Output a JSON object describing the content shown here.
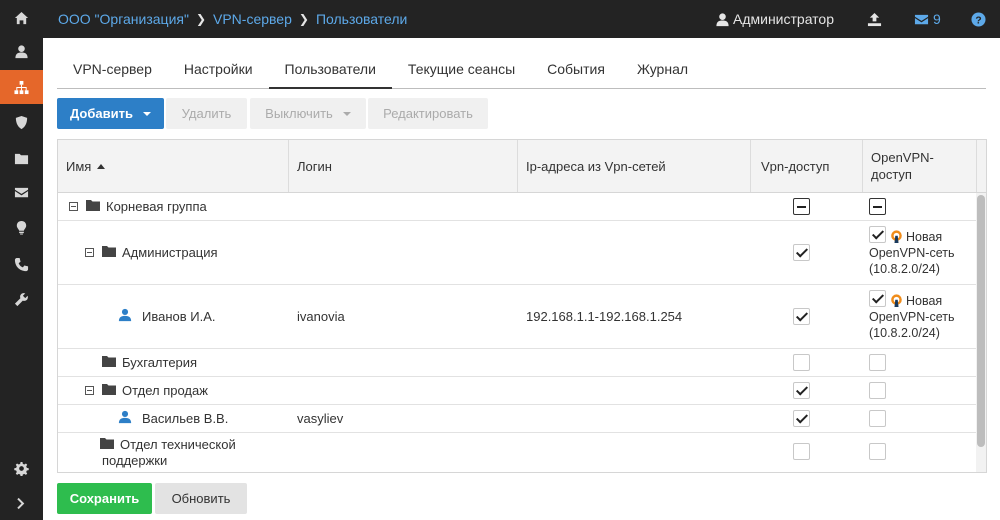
{
  "sidebar": {
    "icons": [
      "home-icon",
      "user-icon",
      "sitemap-icon",
      "shield-icon",
      "folder-icon",
      "envelope-icon",
      "lightbulb-icon",
      "phone-icon",
      "wrench-icon",
      "gear-icon",
      "chevron-right-icon"
    ],
    "active": "sitemap-icon",
    "accent": "#e5672a"
  },
  "header": {
    "breadcrumb": [
      "ООО \"Организация\"",
      "VPN-сервер",
      "Пользователи"
    ],
    "user": "Администратор",
    "mail_count": "9",
    "link_color": "#5da9e9"
  },
  "tabs": [
    {
      "label": "VPN-сервер",
      "active": false
    },
    {
      "label": "Настройки",
      "active": false
    },
    {
      "label": "Пользователи",
      "active": true
    },
    {
      "label": "Текущие сеансы",
      "active": false
    },
    {
      "label": "События",
      "active": false
    },
    {
      "label": "Журнал",
      "active": false
    }
  ],
  "toolbar": {
    "add": "Добавить",
    "delete": "Удалить",
    "disable": "Выключить",
    "edit": "Редактировать",
    "primary_color": "#2d7fc7"
  },
  "table": {
    "columns": [
      "Имя",
      "Логин",
      "Ip-адреса из Vpn-сетей",
      "Vpn-доступ",
      "OpenVPN-доступ"
    ],
    "rows": [
      {
        "type": "group",
        "name": "Корневая группа",
        "login": "",
        "ip": "",
        "vpn": "partial",
        "ovpn": "partial",
        "ovpn_label": ""
      },
      {
        "type": "group",
        "name": "Администрация",
        "login": "",
        "ip": "",
        "vpn": "checked",
        "ovpn": "checked",
        "ovpn_label": "Новая OpenVPN-сеть (10.8.2.0/24)"
      },
      {
        "type": "user",
        "name": "Иванов И.А.",
        "login": "ivanovia",
        "ip": "192.168.1.1-192.168.1.254",
        "vpn": "checked",
        "ovpn": "checked",
        "ovpn_label": "Новая OpenVPN-сеть (10.8.2.0/24)"
      },
      {
        "type": "group",
        "name": "Бухгалтерия",
        "login": "",
        "ip": "",
        "vpn": "unchecked",
        "ovpn": "unchecked",
        "ovpn_label": ""
      },
      {
        "type": "group",
        "name": "Отдел продаж",
        "login": "",
        "ip": "",
        "vpn": "checked",
        "ovpn": "unchecked",
        "ovpn_label": ""
      },
      {
        "type": "user",
        "name": "Васильев В.В.",
        "login": "vasyliev",
        "ip": "",
        "vpn": "checked",
        "ovpn": "unchecked",
        "ovpn_label": ""
      },
      {
        "type": "group",
        "name": "Отдел технической поддержки",
        "login": "",
        "ip": "",
        "vpn": "unchecked",
        "ovpn": "unchecked",
        "ovpn_label": ""
      }
    ]
  },
  "footer": {
    "save": "Сохранить",
    "refresh": "Обновить",
    "save_color": "#2ebd4e"
  }
}
